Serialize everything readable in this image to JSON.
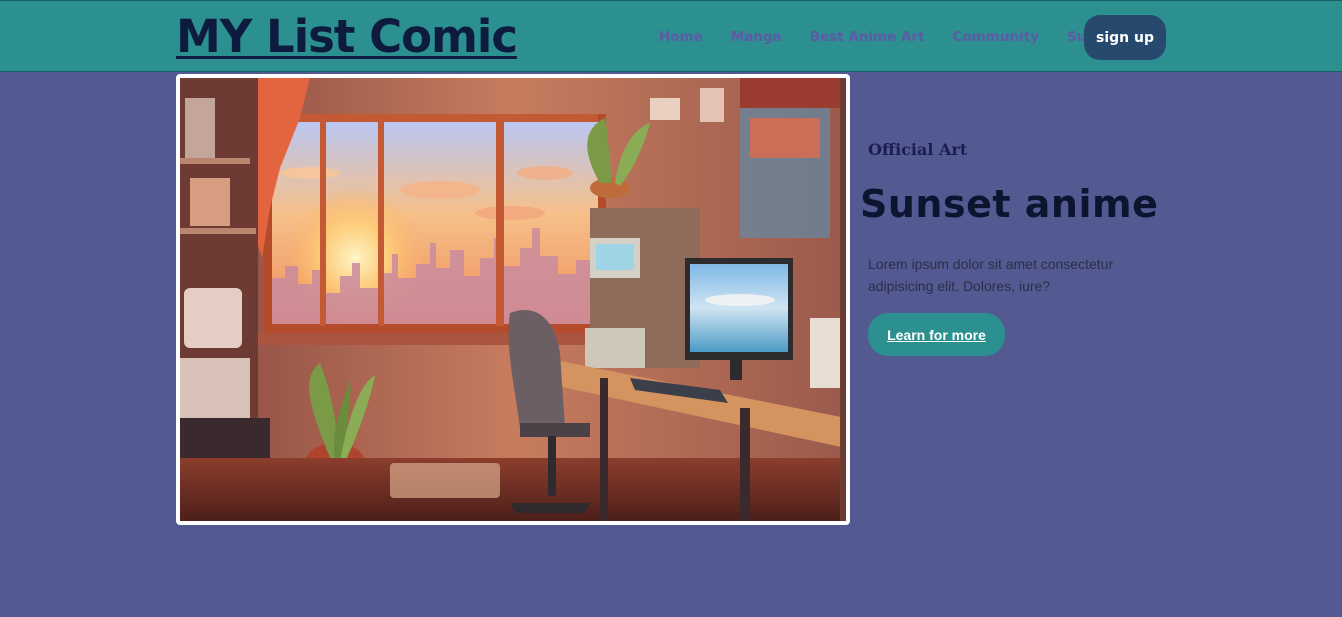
{
  "brand": {
    "title": "MY List Comic"
  },
  "nav": {
    "links": [
      {
        "label": "Home"
      },
      {
        "label": "Manga"
      },
      {
        "label": "Best Anime Art"
      },
      {
        "label": "Community"
      },
      {
        "label": "Support"
      }
    ],
    "signup_label": "sign up"
  },
  "hero": {
    "image_icon": "anime-room-sunset-illustration",
    "kicker": "Official Art",
    "headline": "Sunset anime",
    "description": "Lorem ipsum dolor sit amet consectetur adipisicing elit. Dolores, iure?",
    "cta_label": "Learn for more"
  },
  "colors": {
    "page_background": "#525a91",
    "navbar": "#2b908f",
    "brand_text": "#0d1b3e",
    "nav_link": "#5e5aa8",
    "signup_button": "#27496e",
    "cta_button": "#2b908f"
  }
}
